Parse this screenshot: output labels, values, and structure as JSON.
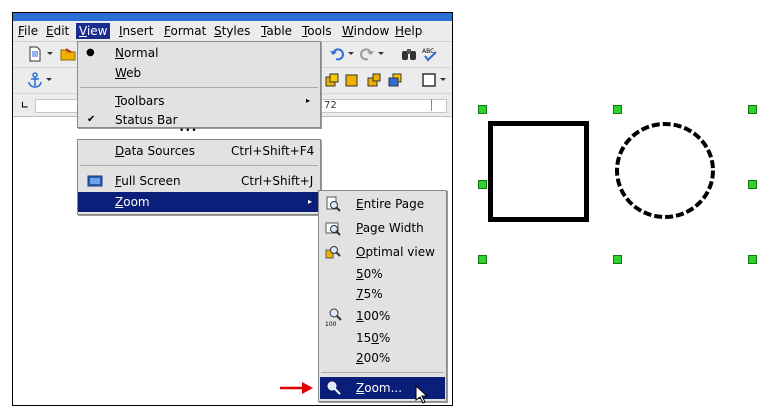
{
  "menubar": {
    "items": [
      {
        "label": "File",
        "mnemonic": "F",
        "rest": "ile"
      },
      {
        "label": "Edit",
        "mnemonic": "E",
        "rest": "dit"
      },
      {
        "label": "View",
        "mnemonic": "V",
        "rest": "iew"
      },
      {
        "label": "Insert",
        "mnemonic": "I",
        "rest": "nsert"
      },
      {
        "label": "Format",
        "mnemonic": "F",
        "rest": "ormat"
      },
      {
        "label": "Styles",
        "mnemonic": "S",
        "rest": "tyles"
      },
      {
        "label": "Table",
        "mnemonic": "T",
        "rest": "able"
      },
      {
        "label": "Tools",
        "mnemonic": "T",
        "rest": "ools"
      },
      {
        "label": "Window",
        "mnemonic": "W",
        "rest": "indow"
      },
      {
        "label": "Help",
        "mnemonic": "H",
        "rest": "elp"
      }
    ],
    "active_index": 2
  },
  "ruler": {
    "mark": "72"
  },
  "view_menu": {
    "normal": {
      "mn": "N",
      "rest": "ormal"
    },
    "web": {
      "mn": "W",
      "rest": "eb"
    },
    "toolbars": {
      "mn": "T",
      "rest": "oolbars"
    },
    "status_bar": "Status Bar",
    "more_indicator": "• • •",
    "data_sources": {
      "mn": "D",
      "rest": "ata Sources",
      "shortcut": "Ctrl+Shift+F4"
    },
    "full_screen": {
      "mn": "F",
      "rest": "ull Screen",
      "shortcut": "Ctrl+Shift+J"
    },
    "zoom": {
      "mn": "Z",
      "rest": "oom"
    }
  },
  "zoom_submenu": {
    "entire_page": {
      "mn": "E",
      "rest": "ntire Page"
    },
    "page_width": {
      "mn": "P",
      "rest": "age Width"
    },
    "optimal_view": {
      "mn": "O",
      "rest": "ptimal view"
    },
    "p50": {
      "mn": "5",
      "rest": "0%"
    },
    "p75": {
      "mn": "7",
      "rest": "5%"
    },
    "p100": {
      "mn": "1",
      "rest": "00%"
    },
    "p150": {
      "pre": "15",
      "mn": "0",
      "rest": "%"
    },
    "p200": {
      "mn": "2",
      "rest": "00%"
    },
    "zoom_dialog": {
      "mn": "Z",
      "rest": "oom..."
    },
    "badge_100": "100"
  },
  "colors": {
    "menu_highlight": "#0a1f7a",
    "arrow": "#e00000",
    "handle": "#2ed12e"
  }
}
